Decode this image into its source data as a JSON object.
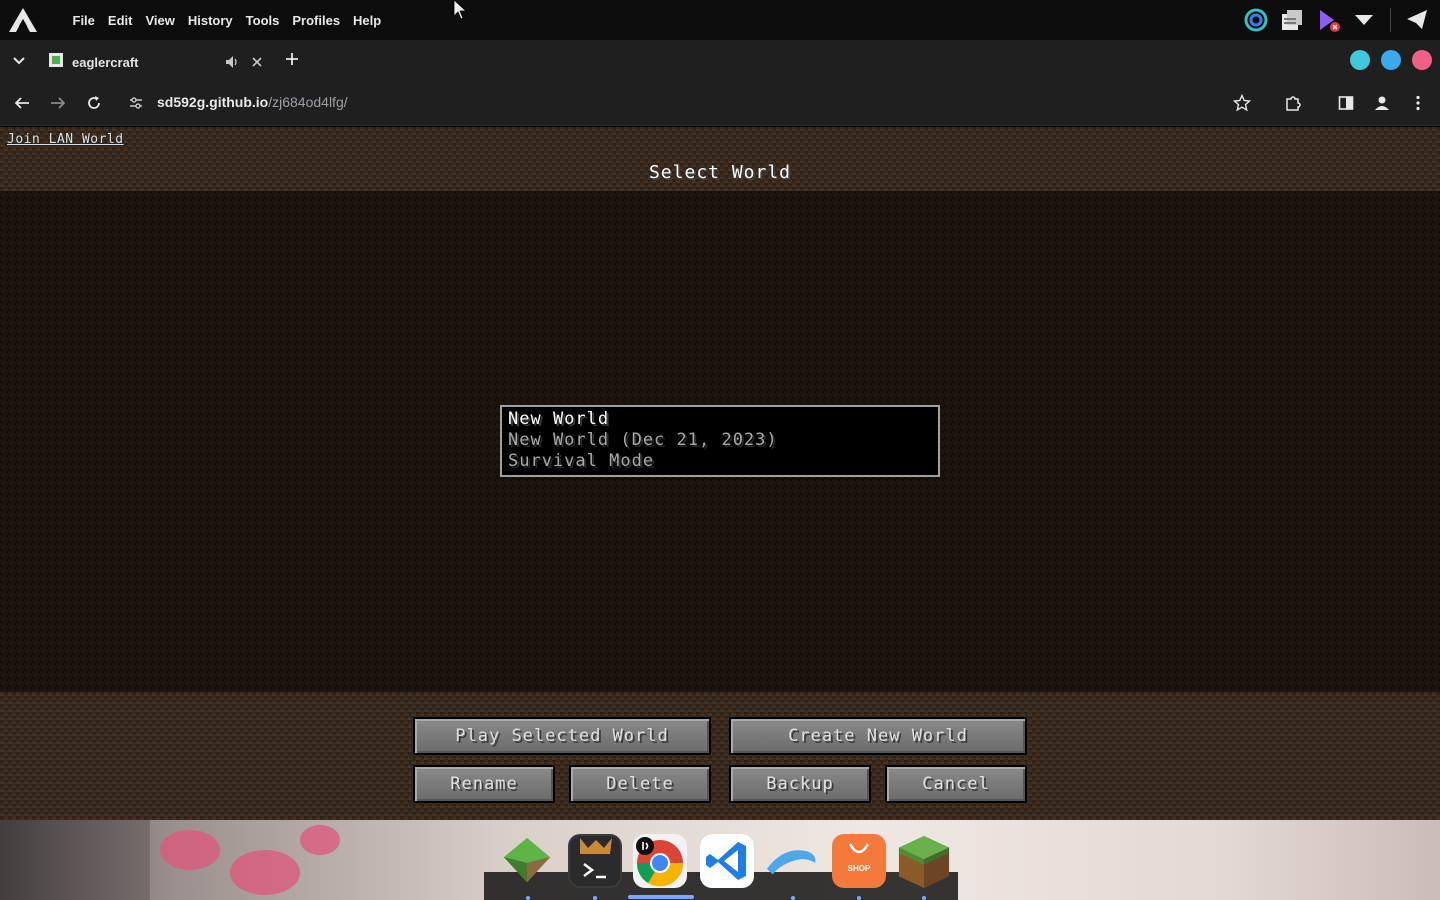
{
  "menubar": {
    "menus": [
      "File",
      "Edit",
      "View",
      "History",
      "Tools",
      "Profiles",
      "Help"
    ]
  },
  "tabs": [
    {
      "title": "eaglercraft",
      "audio": true
    }
  ],
  "window_controls": {
    "colors": [
      "#3fc9d9",
      "#3aa9f0",
      "#ef5f8a"
    ]
  },
  "address_bar": {
    "host": "sd592g.github.io",
    "path": "/zj684od4lfg/"
  },
  "game": {
    "join_lan": "Join LAN World",
    "title": "Select World",
    "worlds": [
      {
        "name": "New World",
        "detail": "New World (Dec 21, 2023)",
        "mode": "Survival Mode"
      }
    ],
    "buttons": {
      "play": "Play Selected World",
      "create": "Create New World",
      "rename": "Rename",
      "delete": "Delete",
      "backup": "Backup",
      "cancel": "Cancel"
    }
  },
  "dock": {
    "apps": [
      "minecraft-launcher",
      "terminal",
      "chrome",
      "vscode",
      "dolphin",
      "shop",
      "minecraft"
    ],
    "shop_label": "SHOP"
  }
}
